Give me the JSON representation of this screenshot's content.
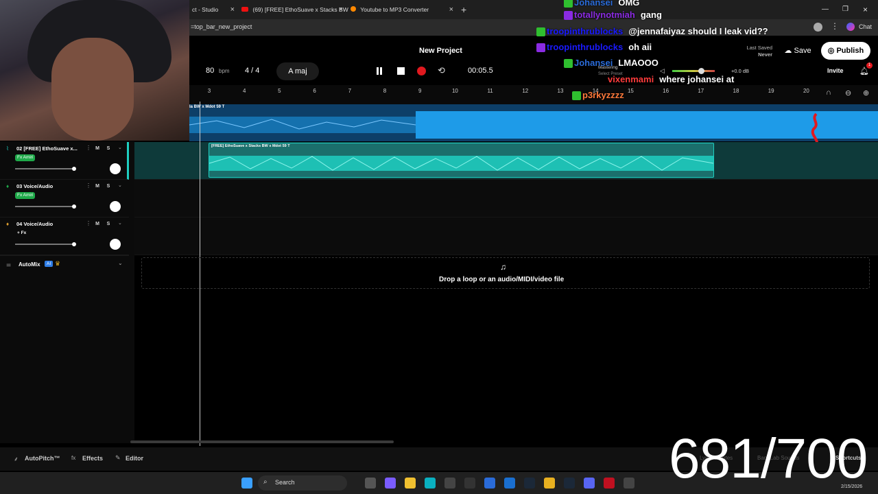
{
  "browser": {
    "tabs": [
      {
        "label": "ct - Studio"
      },
      {
        "label": "(69) [FREE] EthoSuave x Stacks BW"
      },
      {
        "label": "Youtube to MP3 Converter"
      }
    ],
    "new_tab": "+",
    "url": "=top_bar_new_project",
    "chat_label": "Chat"
  },
  "app": {
    "project_title": "New Project",
    "last_saved_label": "Last Saved",
    "last_saved_value": "Never",
    "save_label": "Save",
    "publish_label": "Publish",
    "invite_label": "Invite",
    "notif_count": "1",
    "tempo": "80",
    "tempo_unit": "bpm",
    "time_sig": "4 / 4",
    "key": "A maj",
    "time": "00:05.5",
    "mastering_label": "Mastering",
    "preset_label": "Select Preset",
    "volume_db": "+0.0 dB"
  },
  "ruler": [
    "3",
    "4",
    "5",
    "6",
    "7",
    "8",
    "9",
    "10",
    "11",
    "12",
    "13",
    "14",
    "15",
    "16",
    "17",
    "18",
    "19",
    "20"
  ],
  "tracks": [
    {
      "name": "02 [FREE] EthoSuave x...",
      "fx": "Fx Amiri",
      "fx_active": true
    },
    {
      "name": "03 Voice/Audio",
      "fx": "Fx Amiri",
      "fx_active": true
    },
    {
      "name": "04 Voice/Audio",
      "fx": "+ Fx",
      "fx_active": false
    }
  ],
  "mute_label": "M",
  "solo_label": "S",
  "clips": {
    "top": "la BW x Mdot 59 T",
    "teal": "[FREE] EthoSuave x Stacks BW x Mdot 59 T"
  },
  "automix": {
    "label": "AutoMix",
    "badge": "AI"
  },
  "dropzone": "Drop a loop or an audio/MIDI/video file",
  "bottom_bar": {
    "autopitch": "AutoPitch™",
    "effects": "Effects",
    "editor": "Editor",
    "lyrics": "Lyrics / Notes",
    "bandlab": "BandLab Sounds",
    "shortcuts": "Shortcuts"
  },
  "chat": [
    {
      "user": "Johansei",
      "msg": "OMG",
      "color": "#2a6bd8"
    },
    {
      "user": "totallynotmiah",
      "msg": "gang",
      "color": "#8a2be2"
    },
    {
      "user": "troopinthrublocks",
      "msg": "@jennafaiyaz should I leak vid??",
      "color": "#1a1aff"
    },
    {
      "user": "troopinthrublocks",
      "msg": "oh aii",
      "color": "#1a1aff"
    },
    {
      "user": "Johansei",
      "msg": "LMAOOO",
      "color": "#2a6bd8"
    },
    {
      "user": "vixenmami",
      "msg": "where johansei at",
      "color": "#ff3b3b"
    },
    {
      "user": "p3rkyzzzz",
      "msg": "",
      "color": "#ff7a3b"
    }
  ],
  "overlay_counter": "681/700",
  "taskbar": {
    "search": "Search",
    "date": "2/15/2026"
  },
  "colors": {
    "accent_teal": "#1ecfc1",
    "waveform_blue": "#1e9be8",
    "record_red": "#e0191f",
    "fx_green": "#1faa4a"
  }
}
